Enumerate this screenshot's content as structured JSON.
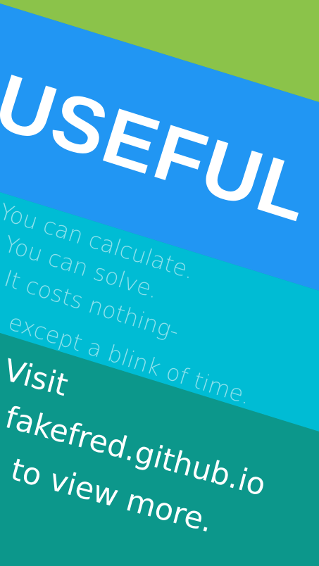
{
  "colors": {
    "green_band": "#8bc34a",
    "blue_band": "#2196f3",
    "cyan_band": "#00bcd4",
    "teal_band": "#0c978b",
    "text": "#ffffff"
  },
  "headline": "USEFUL",
  "tagline": {
    "line1": "You can calculate.",
    "line2": "You can solve.",
    "line3": "It costs nothing-",
    "line4": "except a blink of time."
  },
  "cta": {
    "line1": "Visit",
    "line2": "fakefred.github.io",
    "line3": "to view more."
  }
}
